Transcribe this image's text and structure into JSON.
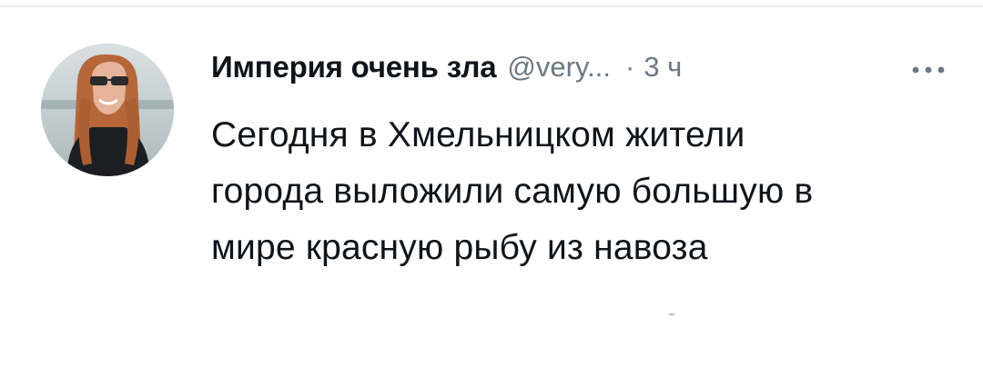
{
  "tweet": {
    "author": {
      "display_name": "Империя очень зла",
      "handle": "@very...",
      "avatar_icon": "avatar-photo"
    },
    "separator": "·",
    "time": "3 ч",
    "more_icon": "more-dots-icon",
    "text_lines": [
      "Сегодня в Хмельницком жители",
      "города выложили самую большую в",
      "мире красную рыбу из навоза"
    ]
  },
  "colors": {
    "text_primary": "#0f1419",
    "text_secondary": "#6b7883",
    "background": "#ffffff"
  }
}
